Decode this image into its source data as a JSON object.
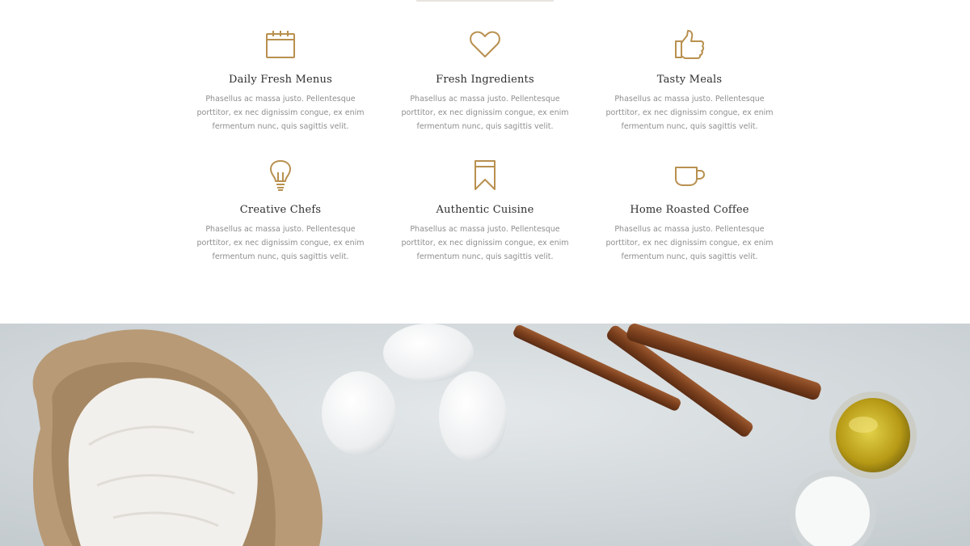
{
  "features": [
    {
      "icon": "calendar-icon",
      "title": "Daily Fresh Menus",
      "desc": "Phasellus ac massa justo. Pellentesque porttitor, ex nec dignissim congue, ex enim fermentum nunc, quis sagittis velit."
    },
    {
      "icon": "heart-icon",
      "title": "Fresh Ingredients",
      "desc": "Phasellus ac massa justo. Pellentesque porttitor, ex nec dignissim congue, ex enim fermentum nunc, quis sagittis velit."
    },
    {
      "icon": "thumbs-up-icon",
      "title": "Tasty Meals",
      "desc": "Phasellus ac massa justo. Pellentesque porttitor, ex nec dignissim congue, ex enim fermentum nunc, quis sagittis velit."
    },
    {
      "icon": "lightbulb-icon",
      "title": "Creative Chefs",
      "desc": "Phasellus ac massa justo. Pellentesque porttitor, ex nec dignissim congue, ex enim fermentum nunc, quis sagittis velit."
    },
    {
      "icon": "bookmark-icon",
      "title": "Authentic Cuisine",
      "desc": "Phasellus ac massa justo. Pellentesque porttitor, ex nec dignissim congue, ex enim fermentum nunc, quis sagittis velit."
    },
    {
      "icon": "coffee-cup-icon",
      "title": "Home Roasted Coffee",
      "desc": "Phasellus ac massa justo. Pellentesque porttitor, ex nec dignissim congue, ex enim fermentum nunc, quis sagittis velit."
    }
  ],
  "colors": {
    "accent": "#b8904f",
    "title": "#2d2d2d",
    "text": "#8e8e8e",
    "photo_bg": "#d7dcdf"
  }
}
